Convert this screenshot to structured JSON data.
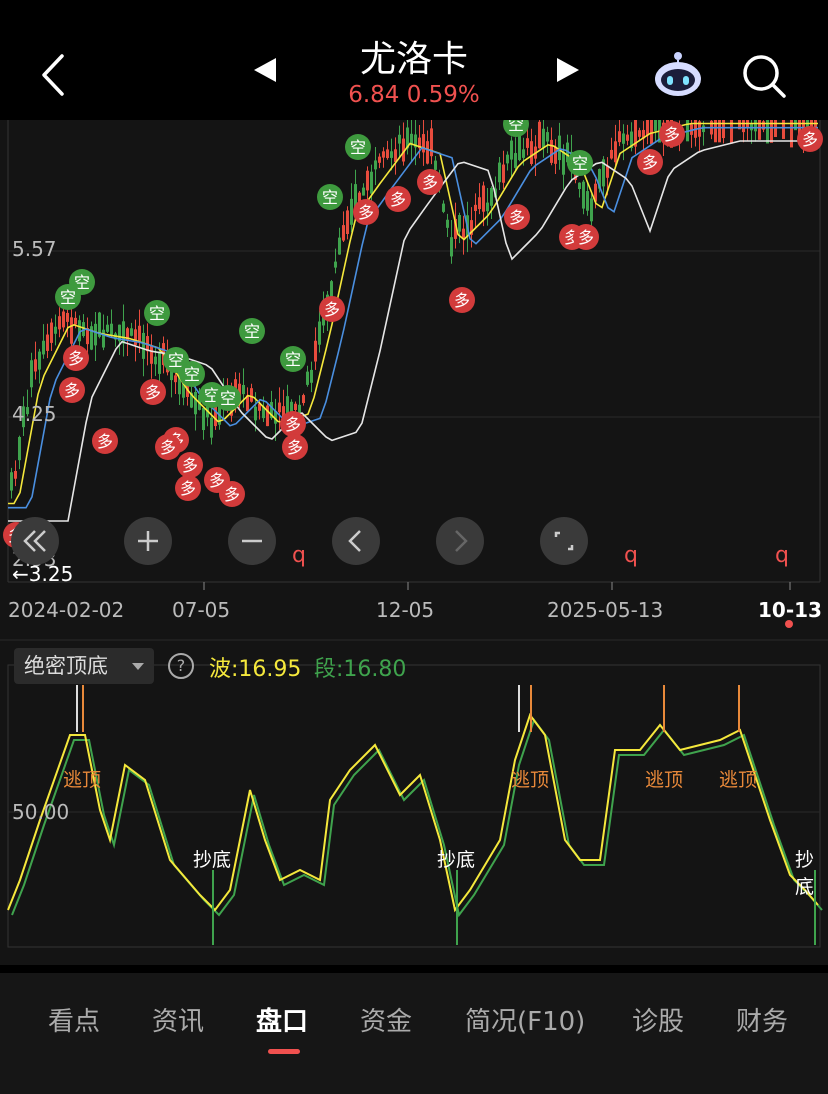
{
  "header": {
    "stock_name": "尤洛卡",
    "price_line": "6.84 0.59%"
  },
  "colors": {
    "up": "#e84c3d",
    "down": "#3fa34d",
    "wave_line": "#f5e83c",
    "segment_line": "#3fa34d",
    "accent": "#f0514f"
  },
  "chart_data": {
    "type": "candlestick",
    "y_axis_labels": [
      "5.57",
      "4.25",
      "2.93"
    ],
    "price_low_marker": "3.25",
    "x_axis_labels": [
      "2024-02-02",
      "07-05",
      "12-05",
      "2025-05-13",
      "10-13"
    ],
    "signal_labels": {
      "long": "多",
      "short": "空"
    },
    "shortcut_markers": [
      "q",
      "q",
      "q"
    ]
  },
  "indicator": {
    "name": "绝密顶底",
    "help": "?",
    "wave": "波:16.95",
    "segment": "段:16.80",
    "level_label": "50.00",
    "escape_top": "逃顶",
    "buy_bottom": "抄底"
  },
  "tabs": [
    "看点",
    "资讯",
    "盘口",
    "资金",
    "简况(F10)",
    "诊股",
    "财务"
  ],
  "active_tab": "盘口"
}
